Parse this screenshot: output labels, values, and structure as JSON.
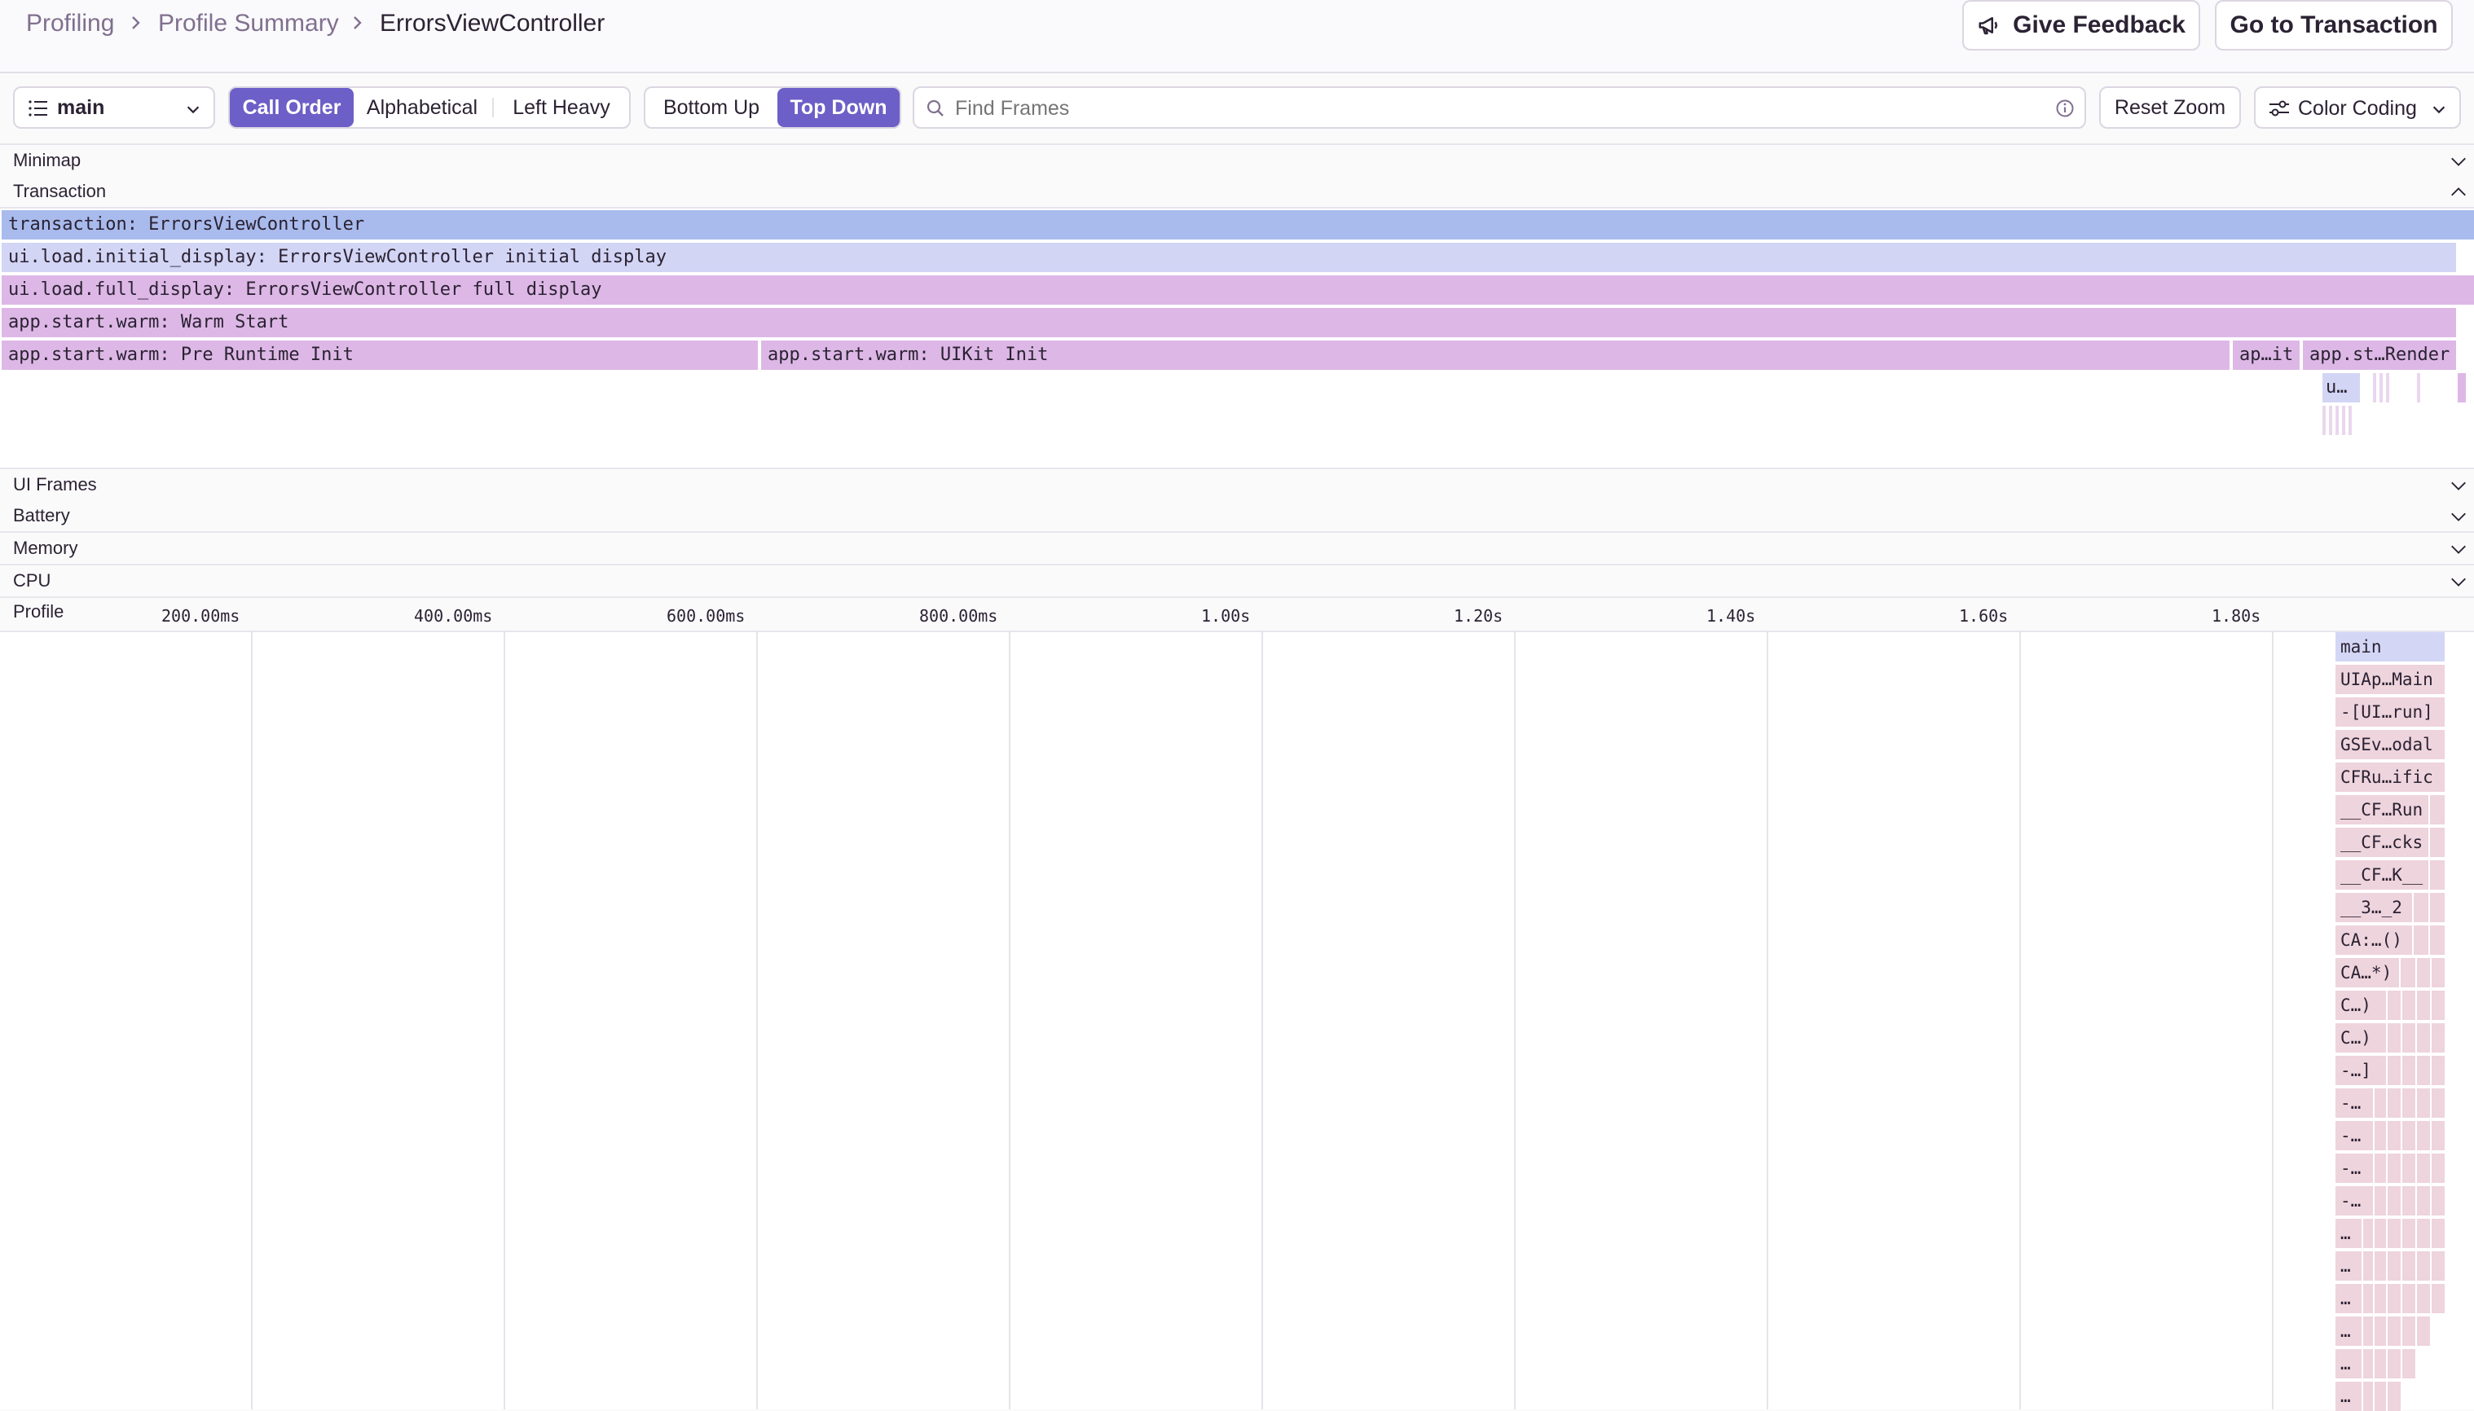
{
  "breadcrumbs": [
    "Profiling",
    "Profile Summary",
    "ErrorsViewController"
  ],
  "header_buttons": {
    "feedback": "Give Feedback",
    "transaction": "Go to Transaction"
  },
  "toolbar": {
    "thread": "main",
    "order": [
      "Call Order",
      "Alphabetical",
      "Left Heavy"
    ],
    "order_active": "Call Order",
    "direction": [
      "Bottom Up",
      "Top Down"
    ],
    "direction_active": "Top Down",
    "search_placeholder": "Find Frames",
    "reset_zoom": "Reset Zoom",
    "color_coding": "Color Coding"
  },
  "sections": {
    "minimap": "Minimap",
    "transaction": "Transaction",
    "ui_frames": "UI Frames",
    "battery": "Battery",
    "memory": "Memory",
    "cpu": "CPU",
    "profile": "Profile"
  },
  "spans": [
    "transaction: ErrorsViewController",
    "ui.load.initial_display: ErrorsViewController initial display",
    "ui.load.full_display: ErrorsViewController full display",
    "app.start.warm: Warm Start",
    "app.start.warm: Pre Runtime Init",
    "app.start.warm: UIKit Init",
    "ap…it",
    "app.st…Render",
    "u…"
  ],
  "colors": {
    "accent": "#6c5fc7",
    "span_transaction": "#a9bbed",
    "span_initial": "#d3d5f5",
    "span_app": "#ddb8e6",
    "frame_main": "#d4d6f5",
    "frame_default": "#eed4dc"
  },
  "axis_ticks": [
    "200.00ms",
    "400.00ms",
    "600.00ms",
    "800.00ms",
    "1.00s",
    "1.20s",
    "1.40s",
    "1.60s",
    "1.80s"
  ],
  "flamegraph_frames": [
    "main",
    "UIAp…Main",
    "-[UI…run]",
    "GSEv…odal",
    "CFRu…ific",
    "__CF…Run",
    "__CF…cks",
    "__CF…K__",
    "__3…_2",
    "CA:…()",
    "CA…*)",
    "C…)",
    "C…)",
    "-…]",
    "-…",
    "-…",
    "-…",
    "-…",
    "…",
    "…",
    "…",
    "…",
    "…",
    "…"
  ],
  "icons": {
    "thread_list": "list-icon",
    "feedback": "megaphone-icon",
    "search": "search-icon",
    "info": "info-icon",
    "color": "sliders-icon",
    "chevron": "chevron-down-icon"
  }
}
